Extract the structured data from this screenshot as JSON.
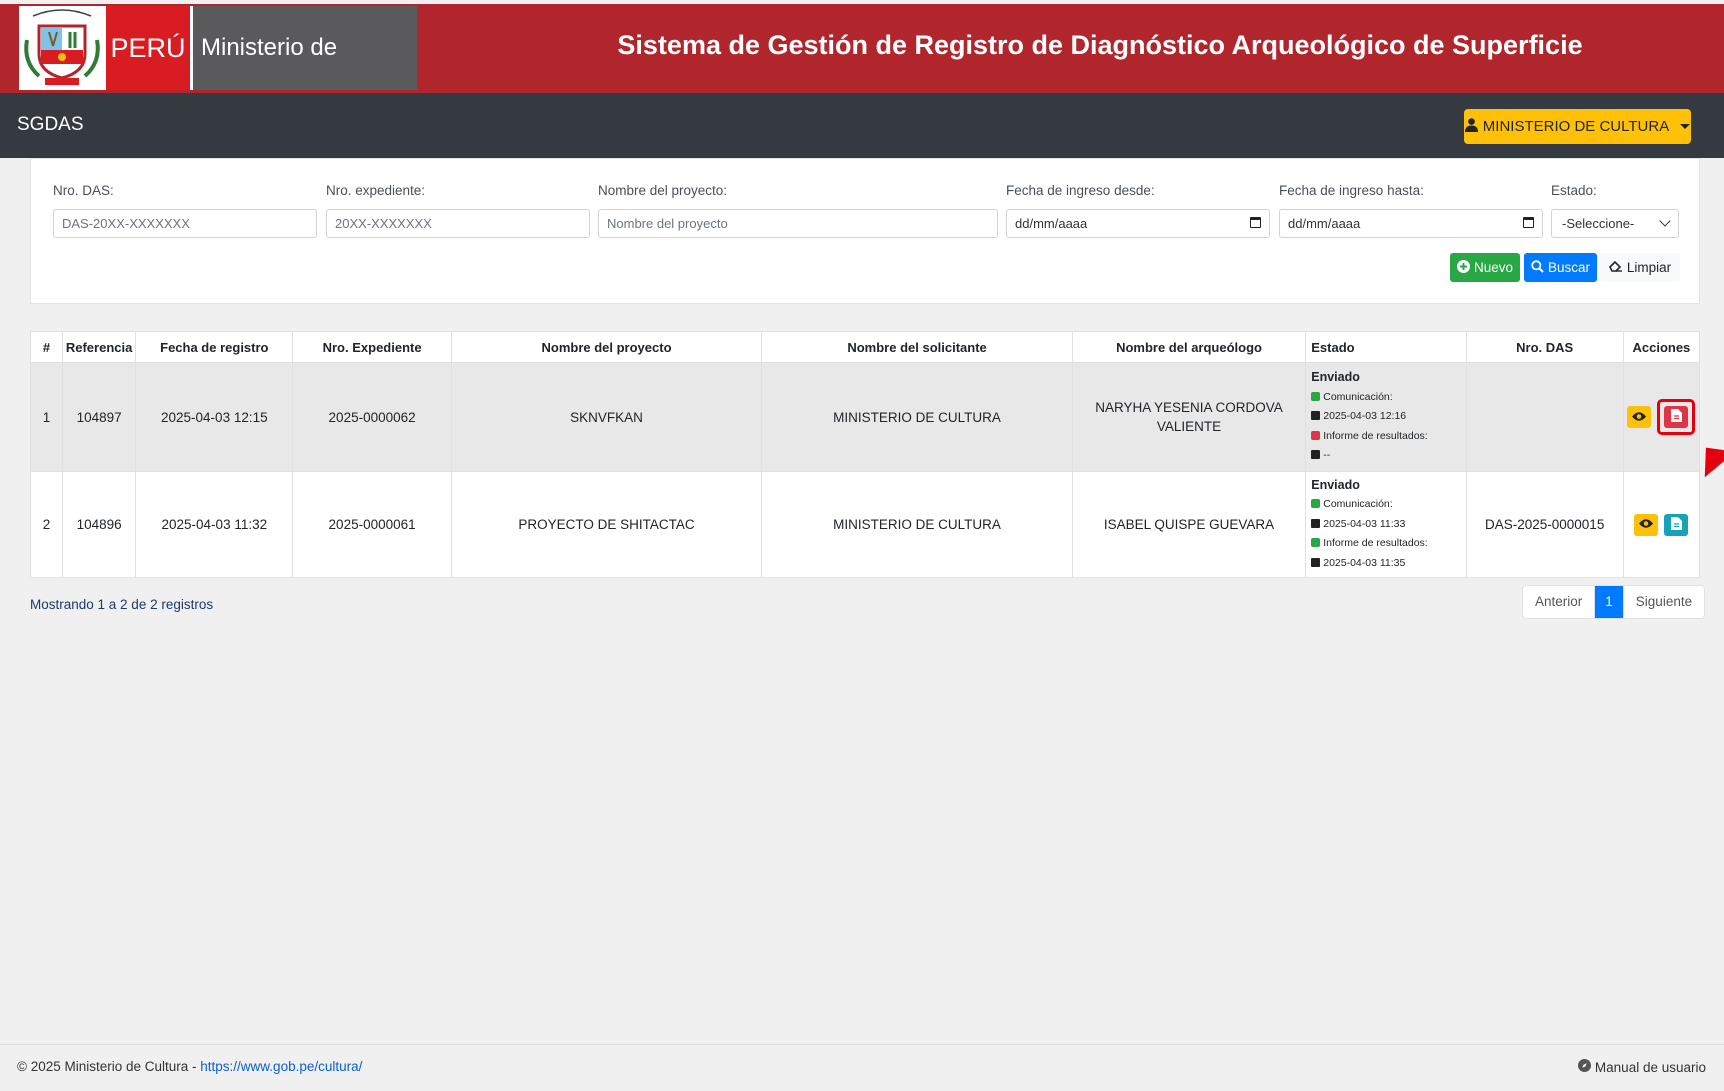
{
  "header": {
    "country": "PERÚ",
    "ministry": "Ministerio de Cultura",
    "title": "Sistema de Gestión de Registro de Diagnóstico Arqueológico de Superficie"
  },
  "navbar": {
    "brand": "SGDAS",
    "user_label": "MINISTERIO DE CULTURA"
  },
  "filters": {
    "nro_das": {
      "label": "Nro. DAS:",
      "placeholder": "DAS-20XX-XXXXXXX"
    },
    "nro_expediente": {
      "label": "Nro. expediente:",
      "placeholder": "20XX-XXXXXXX"
    },
    "nombre_proyecto": {
      "label": "Nombre del proyecto:",
      "placeholder": "Nombre del proyecto"
    },
    "fecha_desde": {
      "label": "Fecha de ingreso desde:",
      "value": "dd/mm/aaaa"
    },
    "fecha_hasta": {
      "label": "Fecha de ingreso hasta:",
      "value": "dd/mm/aaaa"
    },
    "estado": {
      "label": "Estado:",
      "value": "-Seleccione-"
    }
  },
  "buttons": {
    "nuevo": "Nuevo",
    "buscar": "Buscar",
    "limpiar": "Limpiar"
  },
  "table": {
    "headers": [
      "#",
      "Referencia",
      "Fecha de registro",
      "Nro. Expediente",
      "Nombre del proyecto",
      "Nombre del solicitante",
      "Nombre del arqueólogo",
      "Estado",
      "Nro. DAS",
      "Acciones"
    ],
    "rows": [
      {
        "num": "1",
        "referencia": "104897",
        "fecha": "2025-04-03 12:15",
        "expediente": "2025-0000062",
        "proyecto": "SKNVFKAN",
        "solicitante": "MINISTERIO DE CULTURA",
        "arqueologo_l1": "NARYHA YESENIA CORDOVA",
        "arqueologo_l2": "VALIENTE",
        "estado": "Enviado",
        "comunicacion_label": "Comunicación:",
        "comunicacion_fecha": "2025-04-03 12:16",
        "informe_label": "Informe de resultados:",
        "informe_fecha": "--",
        "nro_das": ""
      },
      {
        "num": "2",
        "referencia": "104896",
        "fecha": "2025-04-03 11:32",
        "expediente": "2025-0000061",
        "proyecto": "PROYECTO DE SHITACTAC",
        "solicitante": "MINISTERIO DE CULTURA",
        "arqueologo_l1": "ISABEL QUISPE GUEVARA",
        "arqueologo_l2": "",
        "estado": "Enviado",
        "comunicacion_label": "Comunicación:",
        "comunicacion_fecha": "2025-04-03 11:33",
        "informe_label": "Informe de resultados:",
        "informe_fecha": "2025-04-03 11:35",
        "nro_das": "DAS-2025-0000015"
      }
    ]
  },
  "summary": "Mostrando 1 a 2 de 2 registros",
  "pagination": {
    "prev": "Anterior",
    "current": "1",
    "next": "Siguiente"
  },
  "footer": {
    "copyright": "© 2025 Ministerio de Cultura - ",
    "link": "https://www.gob.pe/cultura/",
    "manual": "Manual de usuario"
  },
  "colors": {
    "header_red": "#b1262c",
    "navbar_dark": "#343a40",
    "warning": "#ffc107",
    "success": "#28a745",
    "primary": "#007bff",
    "danger": "#dc3545",
    "info": "#17a2b8"
  }
}
